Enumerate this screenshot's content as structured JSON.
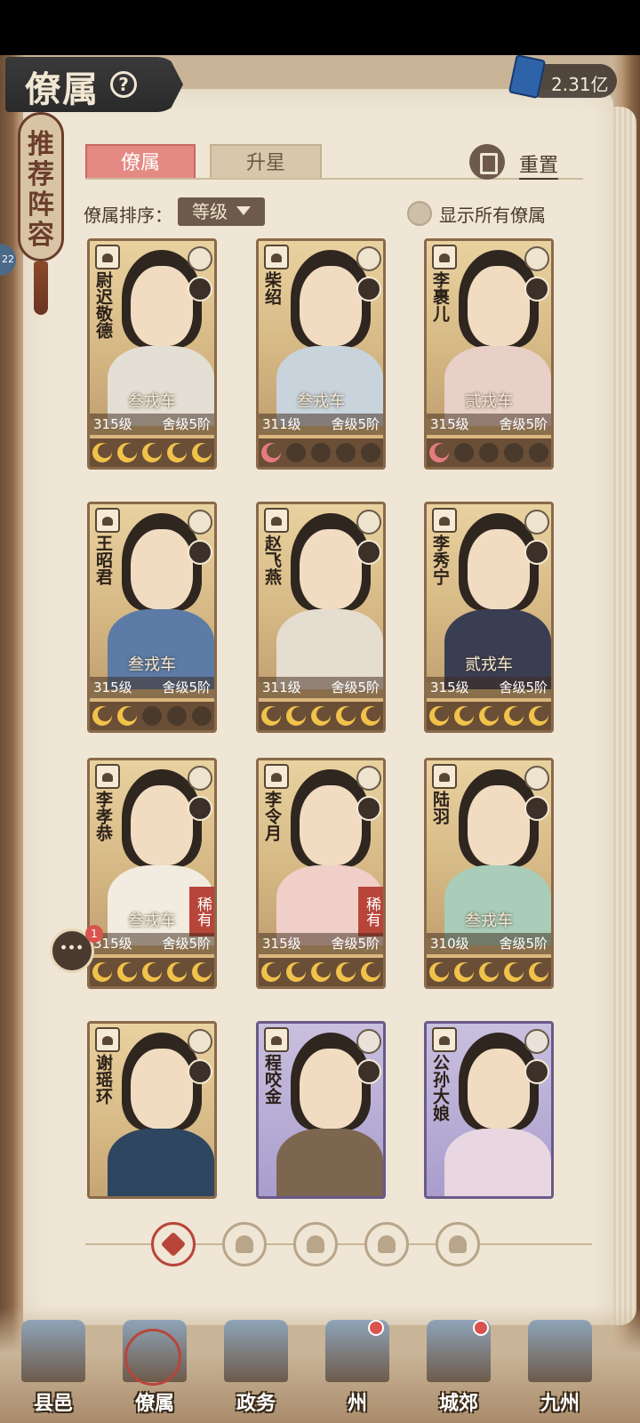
{
  "header": {
    "title": "僚属",
    "currency_value": "2.31亿"
  },
  "side_tag": {
    "label": "推荐阵容",
    "badge": "22"
  },
  "tabs": [
    {
      "label": "僚属",
      "active": true
    },
    {
      "label": "升星",
      "active": false
    }
  ],
  "reset_label": "重置",
  "sort": {
    "label": "僚属排序：",
    "value": "等级"
  },
  "show_all_label": "显示所有僚属",
  "cards": [
    {
      "name": "尉迟敬德",
      "rank": "叁戎车",
      "level": "315级",
      "stage": "舍级5阶",
      "stars": [
        "gold",
        "gold",
        "gold",
        "gold",
        "gold"
      ],
      "rare": "",
      "theme": "gold"
    },
    {
      "name": "柴绍",
      "rank": "叁戎车",
      "level": "311级",
      "stage": "舍级5阶",
      "stars": [
        "pink",
        "empty",
        "empty",
        "empty",
        "empty"
      ],
      "rare": "",
      "theme": "gold"
    },
    {
      "name": "李裹儿",
      "rank": "贰戎车",
      "level": "315级",
      "stage": "舍级5阶",
      "stars": [
        "pink",
        "empty",
        "empty",
        "empty",
        "empty"
      ],
      "rare": "",
      "theme": "gold"
    },
    {
      "name": "王昭君",
      "rank": "叁戎车",
      "level": "315级",
      "stage": "舍级5阶",
      "stars": [
        "gold",
        "gold",
        "empty",
        "empty",
        "empty"
      ],
      "rare": "",
      "theme": "gold"
    },
    {
      "name": "赵飞燕",
      "rank": "",
      "level": "311级",
      "stage": "舍级5阶",
      "stars": [
        "gold",
        "gold",
        "gold",
        "gold",
        "gold"
      ],
      "rare": "",
      "theme": "gold"
    },
    {
      "name": "李秀宁",
      "rank": "贰戎车",
      "level": "315级",
      "stage": "舍级5阶",
      "stars": [
        "gold",
        "gold",
        "gold",
        "gold",
        "gold"
      ],
      "rare": "",
      "theme": "gold"
    },
    {
      "name": "李孝恭",
      "rank": "叁戎车",
      "level": "315级",
      "stage": "舍级5阶",
      "stars": [
        "gold",
        "gold",
        "gold",
        "gold",
        "gold"
      ],
      "rare": "稀有",
      "theme": "gold"
    },
    {
      "name": "李令月",
      "rank": "",
      "level": "315级",
      "stage": "舍级5阶",
      "stars": [
        "gold",
        "gold",
        "gold",
        "gold",
        "gold"
      ],
      "rare": "稀有",
      "theme": "gold"
    },
    {
      "name": "陆羽",
      "rank": "叁戎车",
      "level": "310级",
      "stage": "舍级5阶",
      "stars": [
        "gold",
        "gold",
        "gold",
        "gold",
        "gold"
      ],
      "rare": "",
      "theme": "gold"
    },
    {
      "name": "谢瑶环",
      "rank": "",
      "level": "",
      "stage": "",
      "stars": [],
      "rare": "",
      "theme": "gold"
    },
    {
      "name": "程咬金",
      "rank": "",
      "level": "",
      "stage": "",
      "stars": [],
      "rare": "",
      "theme": "purple"
    },
    {
      "name": "公孙大娘",
      "rank": "",
      "level": "",
      "stage": "",
      "stars": [],
      "rare": "",
      "theme": "purple"
    }
  ],
  "chat_badge": "1",
  "filters": [
    "all",
    "warrior",
    "strategist",
    "mystic",
    "beast"
  ],
  "bottom_nav": [
    {
      "label": "县邑",
      "dot": false,
      "active": false
    },
    {
      "label": "僚属",
      "dot": false,
      "active": true
    },
    {
      "label": "政务",
      "dot": false,
      "active": false
    },
    {
      "label": "州",
      "dot": true,
      "active": false
    },
    {
      "label": "城郊",
      "dot": true,
      "active": false
    },
    {
      "label": "九州",
      "dot": false,
      "active": false
    }
  ]
}
